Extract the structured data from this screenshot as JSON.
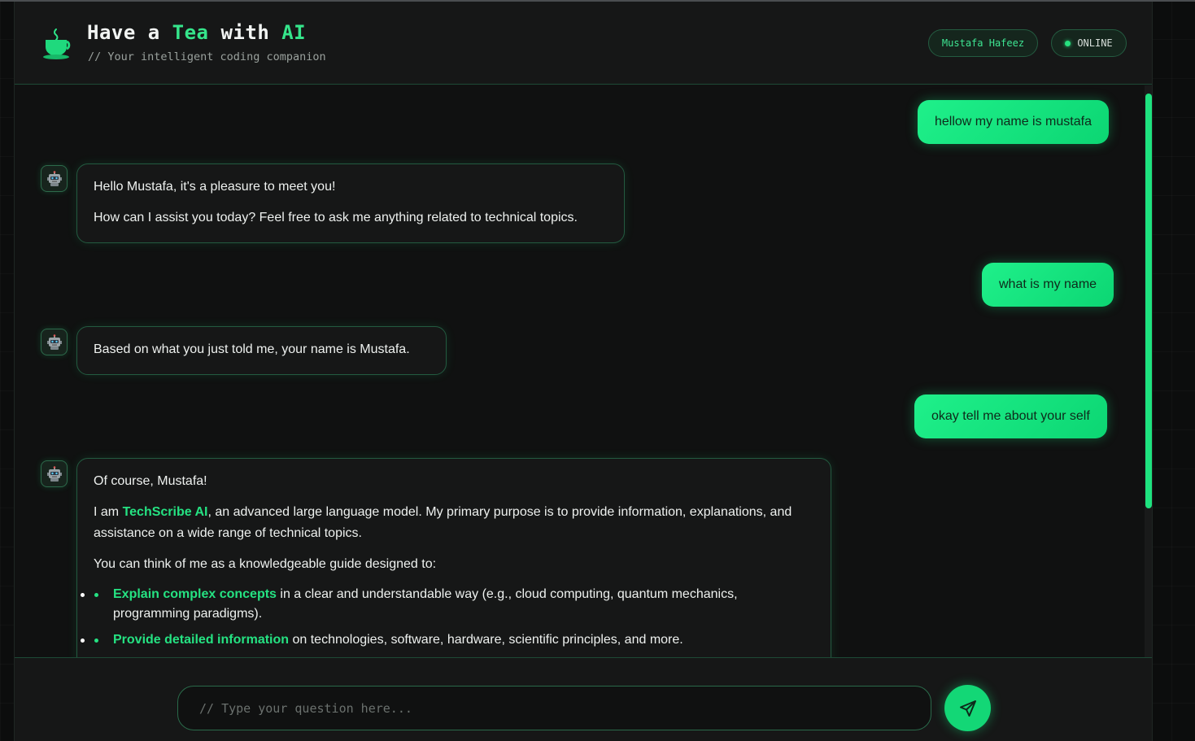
{
  "header": {
    "title_prefix": "Have a ",
    "title_accent1": "Tea",
    "title_mid": " with ",
    "title_accent2": "AI",
    "subtitle": "// Your intelligent coding companion",
    "user_name": "Mustafa Hafeez",
    "status": "ONLINE"
  },
  "colors": {
    "accent": "#25e282",
    "user_bubble": "#1ff08a",
    "background": "#101111",
    "panel": "#161717"
  },
  "icons": {
    "logo": "teacup-icon",
    "avatar": "robot-icon",
    "send": "paper-plane-icon"
  },
  "messages": {
    "user1": "hellow my name is mustafa",
    "bot1": {
      "p1": "Hello Mustafa, it's a pleasure to meet you!",
      "p2": "How can I assist you today? Feel free to ask me anything related to technical topics."
    },
    "user2": "what is my name",
    "bot2": {
      "p1": "Based on what you just told me, your name is Mustafa."
    },
    "user3": "okay tell me about your self",
    "bot3": {
      "p1": "Of course, Mustafa!",
      "p2_pre": "I am ",
      "p2_hl": "TechScribe AI",
      "p2_post": ", an advanced large language model. My primary purpose is to provide information, explanations, and assistance on a wide range of technical topics.",
      "p3": "You can think of me as a knowledgeable guide designed to:",
      "list": [
        {
          "hl": "Explain complex concepts",
          "text": " in a clear and understandable way (e.g., cloud computing, quantum mechanics, programming paradigms)."
        },
        {
          "hl": "Provide detailed information",
          "text": " on technologies, software, hardware, scientific principles, and more."
        }
      ]
    }
  },
  "composer": {
    "placeholder": "// Type your question here..."
  }
}
